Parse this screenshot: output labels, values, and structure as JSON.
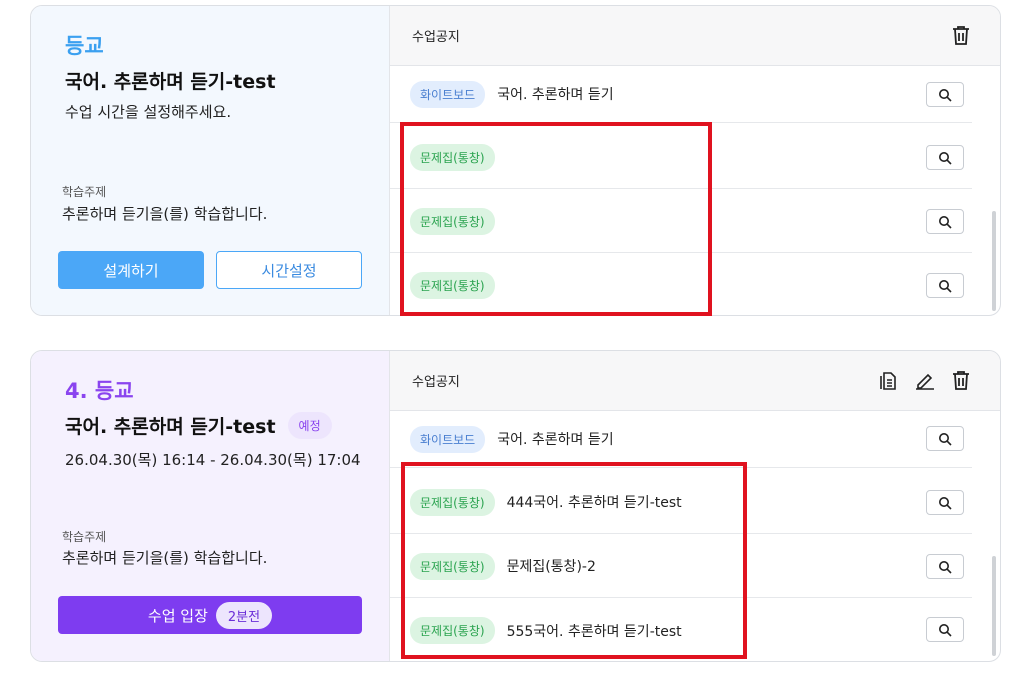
{
  "card1": {
    "period": "등교",
    "title": "국어. 추론하며 듣기-test",
    "subtext": "수업 시간을 설정해주세요.",
    "topic_label": "학습주제",
    "topic_value": "추론하며 듣기을(를) 학습합니다.",
    "design_btn": "설계하기",
    "time_btn": "시간설정",
    "notice_header": "수업공지",
    "rows": [
      {
        "tag": "화이트보드",
        "text": "국어. 추론하며 듣기"
      },
      {
        "tag": "문제집(통창)",
        "text": ""
      },
      {
        "tag": "문제집(통창)",
        "text": ""
      },
      {
        "tag": "문제집(통창)",
        "text": ""
      }
    ]
  },
  "card2": {
    "period": "4. 등교",
    "title": "국어. 추론하며 듣기-test",
    "status_badge": "예정",
    "datetime": "26.04.30(목) 16:14 - 26.04.30(목) 17:04",
    "topic_label": "학습주제",
    "topic_value": "추론하며 듣기을(를) 학습합니다.",
    "enter_btn": "수업 입장",
    "minutes_before": "2분전",
    "notice_header": "수업공지",
    "rows": [
      {
        "tag": "화이트보드",
        "text": "국어. 추론하며 듣기"
      },
      {
        "tag": "문제집(통창)",
        "text": "444국어. 추론하며 듣기-test"
      },
      {
        "tag": "문제집(통창)",
        "text": "문제집(통창)-2"
      },
      {
        "tag": "문제집(통창)",
        "text": "555국어. 추론하며 듣기-test"
      }
    ]
  },
  "colors": {
    "highlight_box": "#e0121f",
    "design_button": "#4ba7f7",
    "enter_button": "#7e3cf0"
  },
  "icons": [
    "trash-icon",
    "copy-document-icon",
    "edit-pencil-icon",
    "search-icon"
  ]
}
